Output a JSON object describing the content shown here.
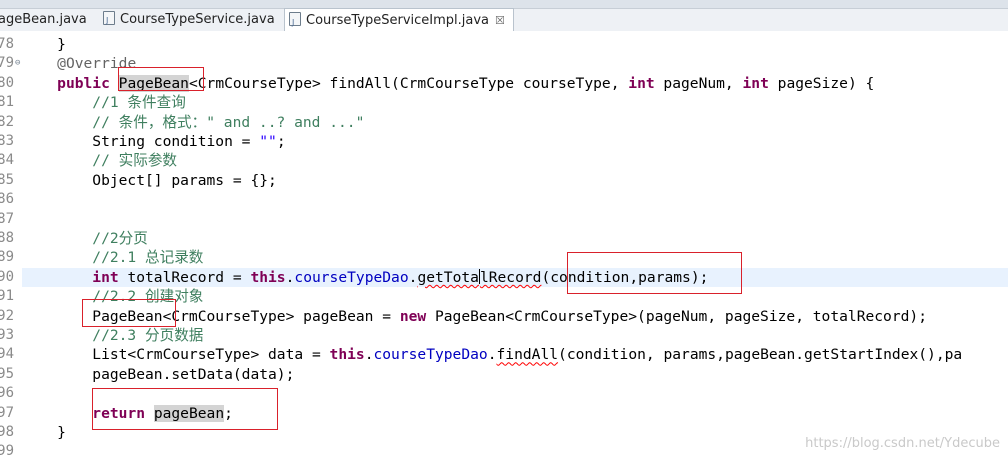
{
  "tabs": [
    {
      "label": "ageBean.java",
      "active": false
    },
    {
      "label": "CourseTypeService.java",
      "active": false
    },
    {
      "label": "CourseTypeServiceImpl.java",
      "active": true,
      "close": "☒"
    }
  ],
  "line_numbers": [
    "78",
    "79",
    "80",
    "81",
    "82",
    "83",
    "84",
    "85",
    "86",
    "87",
    "88",
    "89",
    "90",
    "91",
    "92",
    "93",
    "94",
    "95",
    "96",
    "97",
    "98",
    "99"
  ],
  "code_lines": [
    [
      {
        "t": "    }",
        "c": ""
      }
    ],
    [
      {
        "t": "    ",
        "c": ""
      },
      {
        "t": "@Override",
        "c": "ann"
      }
    ],
    [
      {
        "t": "    ",
        "c": ""
      },
      {
        "t": "public",
        "c": "kw"
      },
      {
        "t": " ",
        "c": ""
      },
      {
        "t": "PageBean",
        "c": "sel"
      },
      {
        "t": "<CrmCourseType> findAll(CrmCourseType courseType, ",
        "c": ""
      },
      {
        "t": "int",
        "c": "kw"
      },
      {
        "t": " pageNum, ",
        "c": ""
      },
      {
        "t": "int",
        "c": "kw"
      },
      {
        "t": " pageSize) {",
        "c": ""
      }
    ],
    [
      {
        "t": "        //1 条件查询",
        "c": "cm"
      }
    ],
    [
      {
        "t": "        // 条件，格式：\" and ..? and ...\"",
        "c": "cm"
      }
    ],
    [
      {
        "t": "        String condition = ",
        "c": ""
      },
      {
        "t": "\"\"",
        "c": "str"
      },
      {
        "t": ";",
        "c": ""
      }
    ],
    [
      {
        "t": "        // 实际参数",
        "c": "cm"
      }
    ],
    [
      {
        "t": "        Object[] params = {};",
        "c": ""
      }
    ],
    [
      {
        "t": "",
        "c": ""
      }
    ],
    [
      {
        "t": "",
        "c": ""
      }
    ],
    [
      {
        "t": "        //2分页",
        "c": "cm"
      }
    ],
    [
      {
        "t": "        //2.1 总记录数",
        "c": "cm"
      }
    ],
    [
      {
        "t": "        ",
        "c": ""
      },
      {
        "t": "int",
        "c": "kw"
      },
      {
        "t": " totalRecord = ",
        "c": ""
      },
      {
        "t": "this",
        "c": "kw"
      },
      {
        "t": ".",
        "c": ""
      },
      {
        "t": "courseTypeDao",
        "c": "fld"
      },
      {
        "t": ".",
        "c": ""
      },
      {
        "t": "getTotalRecord",
        "c": "squig"
      },
      {
        "t": "(condition,params);",
        "c": ""
      }
    ],
    [
      {
        "t": "        //2.2 创建对象",
        "c": "cm"
      }
    ],
    [
      {
        "t": "        PageBean<CrmCourseType> pageBean = ",
        "c": ""
      },
      {
        "t": "new",
        "c": "kw"
      },
      {
        "t": " PageBean<CrmCourseType>(pageNum, pageSize, totalRecord);",
        "c": ""
      }
    ],
    [
      {
        "t": "        //2.3 分页数据",
        "c": "cm"
      }
    ],
    [
      {
        "t": "        List<CrmCourseType> data = ",
        "c": ""
      },
      {
        "t": "this",
        "c": "kw"
      },
      {
        "t": ".",
        "c": ""
      },
      {
        "t": "courseTypeDao",
        "c": "fld"
      },
      {
        "t": ".",
        "c": ""
      },
      {
        "t": "findAll",
        "c": "squig"
      },
      {
        "t": "(condition, params,pageBean.getStartIndex(),pa",
        "c": ""
      }
    ],
    [
      {
        "t": "        pageBean.setData(data);",
        "c": ""
      }
    ],
    [
      {
        "t": "",
        "c": ""
      }
    ],
    [
      {
        "t": "        ",
        "c": ""
      },
      {
        "t": "return",
        "c": "kw"
      },
      {
        "t": " ",
        "c": ""
      },
      {
        "t": "pageBean",
        "c": "sel"
      },
      {
        "t": ";",
        "c": ""
      }
    ],
    [
      {
        "t": "    }",
        "c": ""
      }
    ],
    [
      {
        "t": "",
        "c": ""
      }
    ]
  ],
  "current_line_index": 12,
  "caret": {
    "line": 12,
    "after_text": "getTota"
  },
  "watermark": "https://blog.csdn.net/Ydecube",
  "colors": {
    "keyword": "#7f0055",
    "comment": "#3f7f5f",
    "string": "#2a00ff",
    "field": "#0000c0",
    "annotation_box": "#d9212b"
  }
}
